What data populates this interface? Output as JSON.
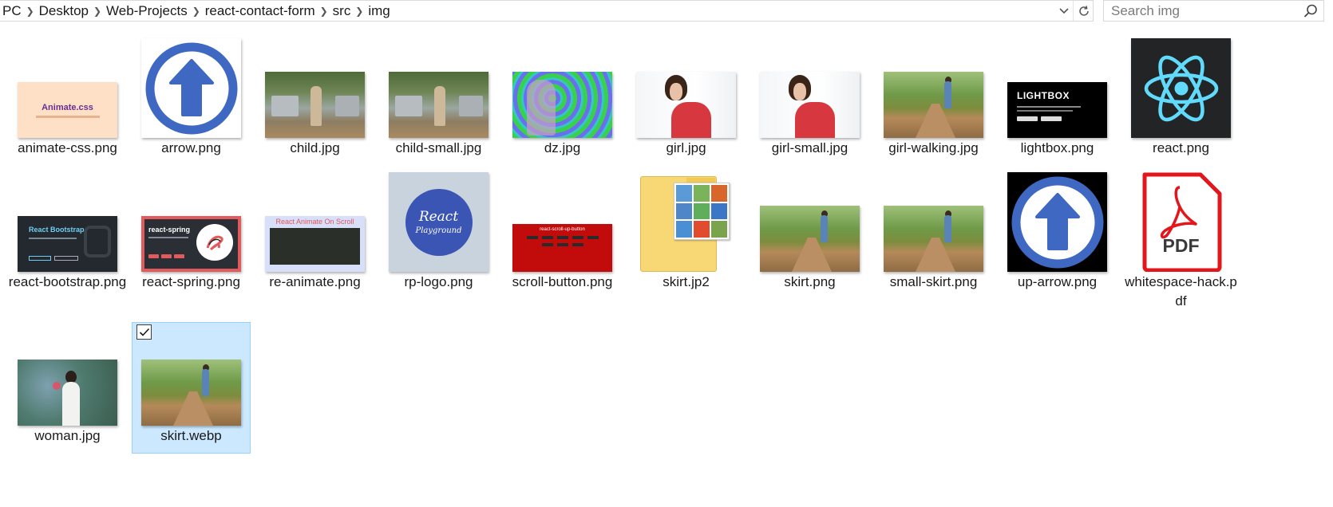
{
  "address_bar": {
    "crumbs": [
      "PC",
      "Desktop",
      "Web-Projects",
      "react-contact-form",
      "src",
      "img"
    ],
    "separator": ">"
  },
  "search": {
    "placeholder": "Search img",
    "value": ""
  },
  "files": [
    {
      "name": "animate-css.png",
      "thumb": "animate-css",
      "thumb_text": "Animate.css"
    },
    {
      "name": "arrow.png",
      "thumb": "arrow-up-blue-on-white"
    },
    {
      "name": "child.jpg",
      "thumb": "photo-child"
    },
    {
      "name": "child-small.jpg",
      "thumb": "photo-child"
    },
    {
      "name": "dz.jpg",
      "thumb": "psychedelic-swirl"
    },
    {
      "name": "girl.jpg",
      "thumb": "photo-girl-red-dress"
    },
    {
      "name": "girl-small.jpg",
      "thumb": "photo-girl-red-dress"
    },
    {
      "name": "girl-walking.jpg",
      "thumb": "photo-girl-walking-path"
    },
    {
      "name": "lightbox.png",
      "thumb": "lightbox",
      "thumb_text": "LIGHTBOX"
    },
    {
      "name": "react.png",
      "thumb": "react-atom-logo"
    },
    {
      "name": "react-bootstrap.png",
      "thumb": "react-bootstrap",
      "thumb_text": "React Bootstrap"
    },
    {
      "name": "react-spring.png",
      "thumb": "react-spring",
      "thumb_text": "react-spring"
    },
    {
      "name": "re-animate.png",
      "thumb": "re-animate",
      "thumb_text": "React Animate On Scroll"
    },
    {
      "name": "rp-logo.png",
      "thumb": "react-playground-logo",
      "thumb_text_1": "React",
      "thumb_text_2": "Playground"
    },
    {
      "name": "scroll-button.png",
      "thumb": "scroll-button",
      "thumb_text": "react-scroll-up-button"
    },
    {
      "name": "skirt.jp2",
      "thumb": "folder-with-pictures"
    },
    {
      "name": "skirt.png",
      "thumb": "photo-girl-walking-path"
    },
    {
      "name": "small-skirt.png",
      "thumb": "photo-girl-walking-path"
    },
    {
      "name": "up-arrow.png",
      "thumb": "arrow-up-blue-on-black"
    },
    {
      "name": "whitespace-hack.pdf",
      "thumb": "pdf-file-icon",
      "thumb_text": "PDF"
    },
    {
      "name": "woman.jpg",
      "thumb": "photo-woman-flowers"
    },
    {
      "name": "skirt.webp",
      "thumb": "photo-girl-walking-path",
      "selected": true
    }
  ],
  "colors": {
    "selection_bg": "#cce8ff",
    "selection_border": "#99d1ff",
    "react_blue": "#61dafb",
    "arrow_blue": "#3f68c3",
    "pdf_red": "#e3161b"
  }
}
